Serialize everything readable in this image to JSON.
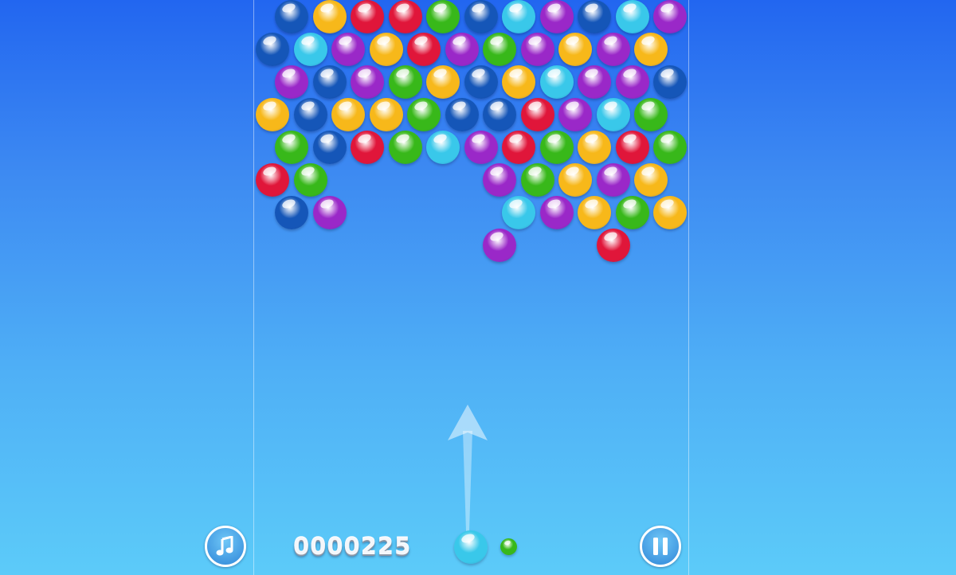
{
  "game": {
    "score": "0000225",
    "colors": {
      "blue": "#1556b8",
      "yellow": "#f7b81a",
      "red": "#e0163a",
      "green": "#38b81a",
      "cyan": "#39c8ea",
      "purple": "#9a28c8",
      "background_top": "#2266f0",
      "background_bottom": "#5ccbf9"
    },
    "grid": [
      [
        "blue",
        "yellow",
        "red",
        "red",
        "green",
        "blue",
        "cyan",
        "purple",
        "blue",
        "cyan",
        "purple"
      ],
      [
        "blue",
        "cyan",
        "purple",
        "yellow",
        "red",
        "purple",
        "green",
        "purple",
        "yellow",
        "purple",
        "yellow"
      ],
      [
        "purple",
        "blue",
        "purple",
        "green",
        "yellow",
        "blue",
        "yellow",
        "cyan",
        "purple",
        "purple",
        "blue"
      ],
      [
        "yellow",
        "blue",
        "yellow",
        "yellow",
        "green",
        "blue",
        "blue",
        "red",
        "purple",
        "cyan",
        "green"
      ],
      [
        "green",
        "blue",
        "red",
        "green",
        "cyan",
        "purple",
        "red",
        "green",
        "yellow",
        "red",
        "green"
      ],
      [
        "red",
        "green",
        null,
        null,
        null,
        null,
        "purple",
        "green",
        "yellow",
        "purple",
        "yellow"
      ],
      [
        "blue",
        "purple",
        null,
        null,
        null,
        null,
        "cyan",
        "purple",
        "yellow",
        "green",
        "yellow"
      ],
      [
        null,
        null,
        null,
        null,
        null,
        null,
        "purple",
        null,
        null,
        "red",
        null
      ]
    ],
    "current_bubble": "cyan",
    "next_bubble": "green",
    "controls": {
      "music_icon": "music-note-icon",
      "pause_icon": "pause-icon"
    }
  }
}
